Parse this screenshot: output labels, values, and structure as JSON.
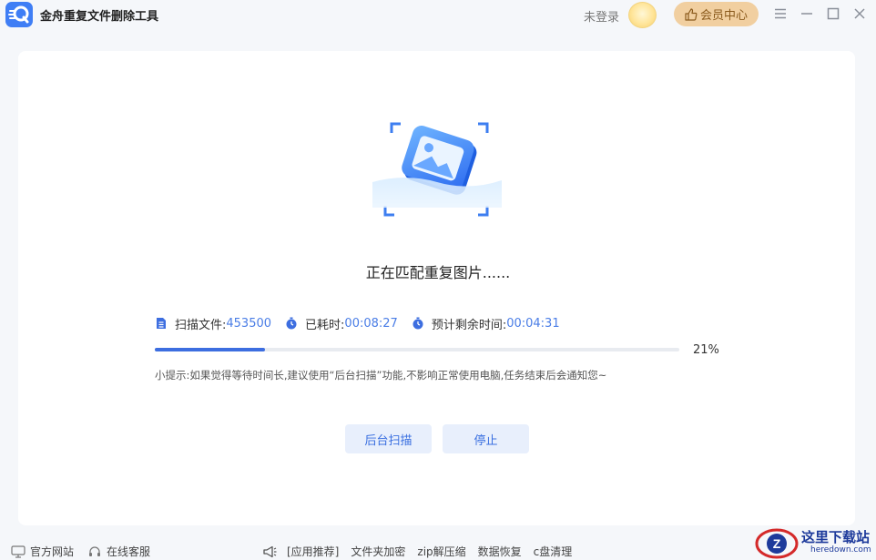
{
  "app": {
    "logo_text": "Q",
    "title": "金舟重复文件删除工具"
  },
  "header": {
    "login_text": "未登录",
    "vip_label": "会员中心",
    "vip_icon": "thumbs-up-icon",
    "menu_icon": "menu-icon",
    "minimize_icon": "minimize-icon",
    "maximize_icon": "maximize-icon",
    "close_icon": "close-icon"
  },
  "main": {
    "status_text": "正在匹配重复图片......",
    "stats": {
      "scanned_label": "扫描文件:",
      "scanned_value": "453500",
      "elapsed_label": "已耗时:",
      "elapsed_value": "00:08:27",
      "remaining_label": "预计剩余时间:",
      "remaining_value": "00:04:31"
    },
    "progress": {
      "fraction": 0.21,
      "percent_text": "21%"
    },
    "tip": "小提示:如果觉得等待时间长,建议使用“后台扫描”功能,不影响正常使用电脑,任务结束后会通知您~",
    "buttons": {
      "background_scan": "后台扫描",
      "stop": "停止"
    }
  },
  "footer": {
    "official_site": "官方网站",
    "online_service": "在线客服",
    "recommend_label": "[应用推荐]",
    "recommend_items": [
      "文件夹加密",
      "zip解压缩",
      "数据恢复",
      "c盘清理"
    ]
  },
  "watermark": {
    "logo_letter": "Z",
    "cn": "这里下载站",
    "en": "heredown.com"
  },
  "colors": {
    "accent": "#3d6ee0",
    "value_text": "#4a7de6",
    "vip_bg": "#f1cfa0",
    "button_bg": "#e8effc"
  }
}
